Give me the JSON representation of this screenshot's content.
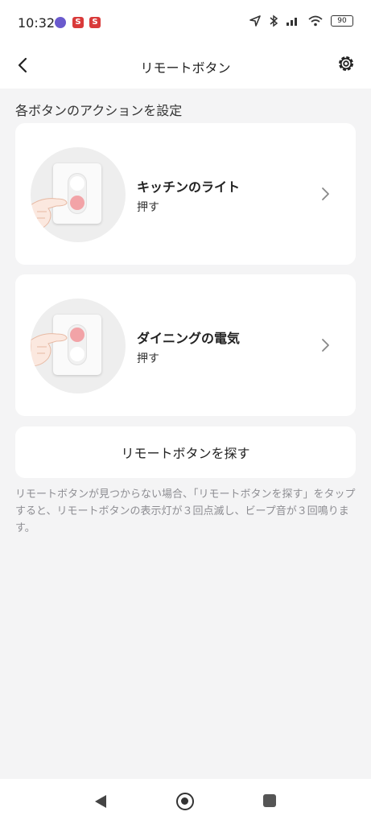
{
  "status_bar": {
    "time": "10:32",
    "app_icon_1": "S",
    "app_icon_2": "S",
    "battery": "90"
  },
  "header": {
    "title": "リモートボタン"
  },
  "section_title": "各ボタンのアクションを設定",
  "buttons": [
    {
      "name": "キッチンのライト",
      "action": "押す",
      "pressed": "bottom"
    },
    {
      "name": "ダイニングの電気",
      "action": "押す",
      "pressed": "top"
    }
  ],
  "find_button": {
    "label": "リモートボタンを探す"
  },
  "hint": "リモートボタンが見つからない場合、「リモートボタンを探す」をタップすると、リモートボタンの表示灯が３回点滅し、ビープ音が３回鳴ります。",
  "colors": {
    "accent_pink": "#f2a3a7",
    "background": "#f4f4f5"
  }
}
